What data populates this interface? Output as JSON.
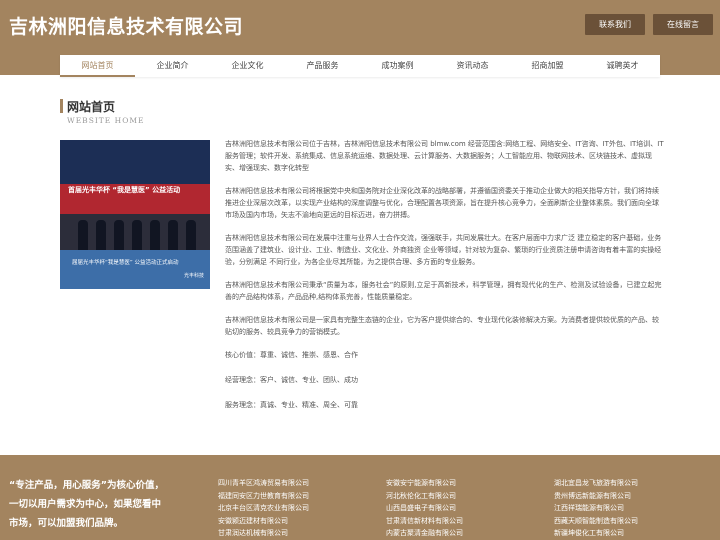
{
  "header": {
    "site_title": "吉林洲阳信息技术有限公司",
    "contact_label": "联系我们",
    "message_label": "在线留言"
  },
  "nav": {
    "items": [
      {
        "label": "网站首页",
        "active": true
      },
      {
        "label": "企业简介"
      },
      {
        "label": "企业文化"
      },
      {
        "label": "产品服务"
      },
      {
        "label": "成功案例"
      },
      {
        "label": "资讯动态"
      },
      {
        "label": "招商加盟"
      },
      {
        "label": "诚聘英才"
      }
    ]
  },
  "section": {
    "title": "网站首页",
    "subtitle": "WEBSITE HOME"
  },
  "photo": {
    "banner": "首届光丰华杯 “我是慧医” 公益活动",
    "caption": "届届光丰华杯“我是慧医” 公益活动正式启动",
    "logo": "光丰科技"
  },
  "intro": {
    "paragraphs": [
      "吉林洲阳信息技术有限公司位于吉林，吉林洲阳信息技术有限公司 blmw.com 经营范围含:网络工程、网络安全、IT咨询、IT外包、IT培训、IT服务管理；软件开发、系统集成、信息系统运维、数据处理、云计算服务、大数据服务；人工智能应用、物联网技术、区块链技术、虚拟现实、增强现实、数字化转型",
      "吉林洲阳信息技术有限公司将根据党中央和国务院对企业深化改革的战略部署，并遵循国资委关于推动企业做大的相关指导方针，我们将持续推进企业深层次改革，以实现产业结构的深度调整与优化，合理配置各项资源，旨在提升核心竞争力，全面刷新企业整体素质。我们面向全球市场及国内市场，矢志不渝地向更远的目标迈进，奋力拼搏。",
      "吉林洲阳信息技术有限公司在发展中注重与业界人士合作交流，强强联手，共同发展壮大。在客户层面中力求广泛 建立稳定的客户基础，业务范围涵盖了建筑业、设计业、工业、制造业、文化业、外商独资 企业等领域，针对较为复杂、繁琐的行业资质注册申请咨询有着丰富的实操经验，分别满足 不同行业，为各企业尽其所能，为之提供合理、多方面的专业服务。",
      "吉林洲阳信息技术有限公司秉承“质量为本，服务社会”的原则,立足于高新技术，科学管理，拥有现代化的生产、检测及试验设备，已建立起完善的产品结构体系，产品品种,结构体系完善，性能质量稳定。",
      "吉林洲阳信息技术有限公司是一家具有完整生态链的企业，它为客户提供综合的、专业现代化装修解决方案。为消费者提供较优质的产品、较贴切的服务、较具竞争力的营销模式。"
    ],
    "values": [
      "核心价值：尊重、诚信、推崇、感恩、合作",
      "经营理念：客户、诚信、专业、团队、成功",
      "服务理念：真诚、专业、精准、周全、可靠"
    ]
  },
  "footer": {
    "slogan": "“专注产品，用心服务”为核心价值，一切以用户需求为中心，如果您看中市场，可以加盟我们品牌。",
    "links_col1": [
      "四川青羊区鸿涛贸易有限公司",
      "福建同安区力世教育有限公司",
      "北京丰台区清克农业有限公司",
      "安徽颍迈建材有限公司",
      "甘肃润达机械有限公司"
    ],
    "links_col2": [
      "安徽安宁能源有限公司",
      "河北秋伦化工有限公司",
      "山西昌盛电子有限公司",
      "甘肃清信新材料有限公司",
      "内蒙古聚清金融有限公司"
    ],
    "links_col3": [
      "湖北宜昌龙飞旅游有限公司",
      "贵州博远新能源有限公司",
      "江西祥瑞能源有限公司",
      "西藏天顺智能制造有限公司",
      "新疆坤俊化工有限公司"
    ]
  }
}
